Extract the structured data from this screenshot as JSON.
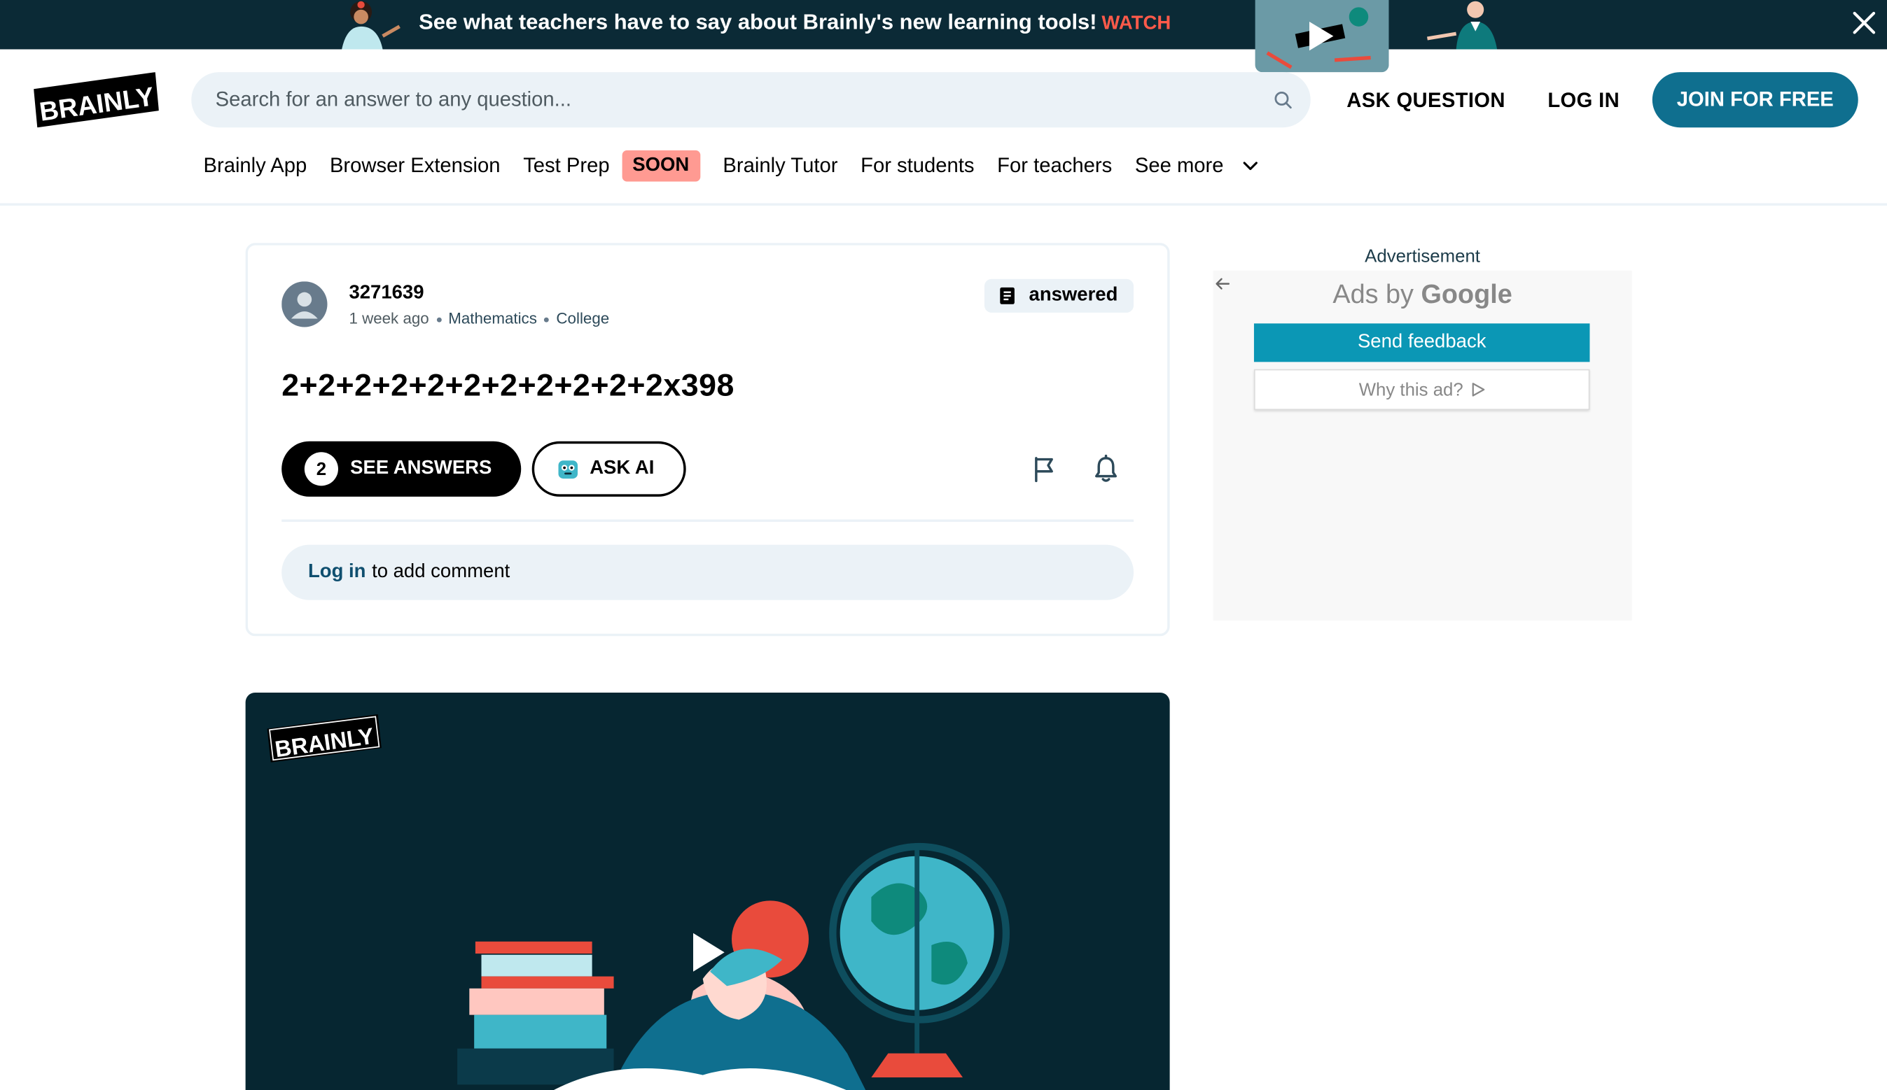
{
  "promo": {
    "text": "See what teachers have to say about Brainly's new learning tools!",
    "watch_label": "WATCH",
    "thumb_text": "BRAINLY"
  },
  "header": {
    "logo_text": "BRAINLY",
    "search_placeholder": "Search for an answer to any question...",
    "ask_question": "ASK QUESTION",
    "log_in": "LOG IN",
    "join": "JOIN FOR FREE"
  },
  "subnav": {
    "items": [
      "Brainly App",
      "Browser Extension",
      "Test Prep",
      "Brainly Tutor",
      "For students",
      "For teachers",
      "See more"
    ],
    "soon_badge": "SOON"
  },
  "question": {
    "user": "3271639",
    "time": "1 week ago",
    "subject": "Mathematics",
    "level": "College",
    "status": "answered",
    "text": "2+2+2+2+2+2+2+2+2+2+2x398",
    "answers_count": "2",
    "see_answers": "SEE ANSWERS",
    "ask_ai": "ASK AI",
    "comment_login": "Log in",
    "comment_rest": "to add comment"
  },
  "video": {
    "logo_text": "BRAINLY"
  },
  "ad": {
    "label": "Advertisement",
    "ads_by": "Ads by",
    "google": "Google",
    "send_feedback": "Send feedback",
    "why_this_ad": "Why this ad?"
  },
  "colors": {
    "banner_bg": "#0b2a36",
    "brand_blue": "#0f6f8f",
    "watch_red": "#ff5a4a",
    "soon_pink": "#ff9a92",
    "light_bg": "#ebf2f7",
    "ad_teal": "#0b97b5"
  },
  "icons": [
    "close-icon",
    "search-icon",
    "chevron-down-icon",
    "avatar-icon",
    "answered-icon",
    "ai-robot-icon",
    "flag-icon",
    "bell-icon",
    "play-icon",
    "back-arrow-icon",
    "ad-choices-icon"
  ]
}
